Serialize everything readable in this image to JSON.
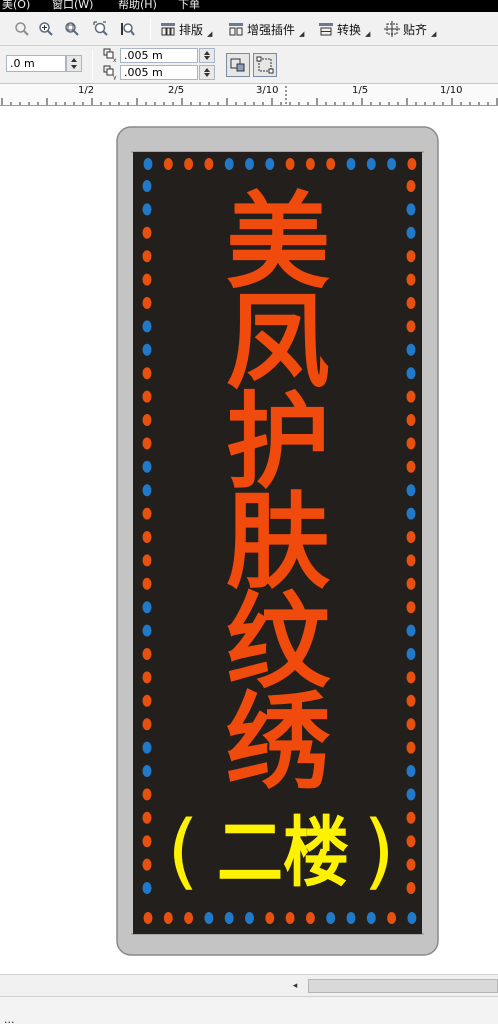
{
  "menubar": {
    "items": [
      "美(O)",
      "窗口(W)",
      "帮助(H)",
      "下单"
    ]
  },
  "toolbar": {
    "icons": [
      "zoom-icon",
      "zoom-in-icon",
      "zoom-selected-icon",
      "zoom-page-icon",
      "zoom-width-icon"
    ],
    "buttons": [
      {
        "label": "排版",
        "icon": "layout-icon"
      },
      {
        "label": "增强插件",
        "icon": "plugin-icon"
      },
      {
        "label": "转换",
        "icon": "convert-icon"
      },
      {
        "label": "贴齐",
        "icon": "snap-icon"
      }
    ]
  },
  "propbar": {
    "position_value": ".0 m",
    "offset_x_value": ".005 m",
    "offset_y_value": ".005 m"
  },
  "ruler": {
    "labels": [
      "1/2",
      "2/5",
      "3/10",
      "1/5",
      "1/10"
    ]
  },
  "sign": {
    "line1": "美凤护肤纹绣",
    "chars": [
      "美",
      "凤",
      "护",
      "肤",
      "纹",
      "绣"
    ],
    "floor_label": "二楼",
    "paren_left": "(",
    "paren_right": ")",
    "colors": {
      "frame": "#c4c4c4",
      "frame_edge": "#8a8a8a",
      "board": "#231f1c",
      "title_text": "#f04a0c",
      "floor_text": "#fff200",
      "dot_orange": "#e8500f",
      "dot_blue": "#2179c9"
    }
  },
  "statusbar": {
    "text": "..."
  }
}
